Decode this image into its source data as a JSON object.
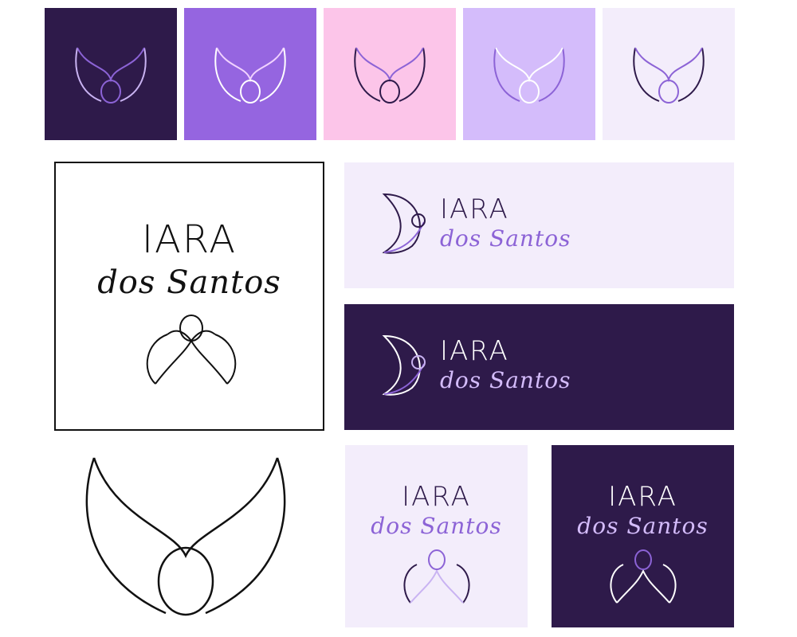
{
  "brand": {
    "name": "IARA",
    "surname": "dos Santos"
  },
  "colors": {
    "dark_purple": "#2e1a4a",
    "medium_purple": "#9565e0",
    "pink": "#fcc5e9",
    "lilac": "#d4bcfb",
    "pale_lavender": "#f3edfb",
    "black": "#111111",
    "white": "#ffffff"
  },
  "palette": [
    {
      "name": "dark_purple",
      "bg": "#2e1a4a",
      "outer": "#c9b3f2",
      "inner": "#8c63d6"
    },
    {
      "name": "medium_purple",
      "bg": "#9565e0",
      "outer": "#ffffff",
      "inner": "#f1d2ff"
    },
    {
      "name": "pink",
      "bg": "#fcc5e9",
      "outer": "#2e1a4a",
      "inner": "#8c63d6"
    },
    {
      "name": "lilac",
      "bg": "#d4bcfb",
      "outer": "#8c63d6",
      "inner": "#ffffff"
    },
    {
      "name": "pale_lavender",
      "bg": "#f3edfb",
      "outer": "#2e1a4a",
      "inner": "#8c63d6"
    }
  ]
}
